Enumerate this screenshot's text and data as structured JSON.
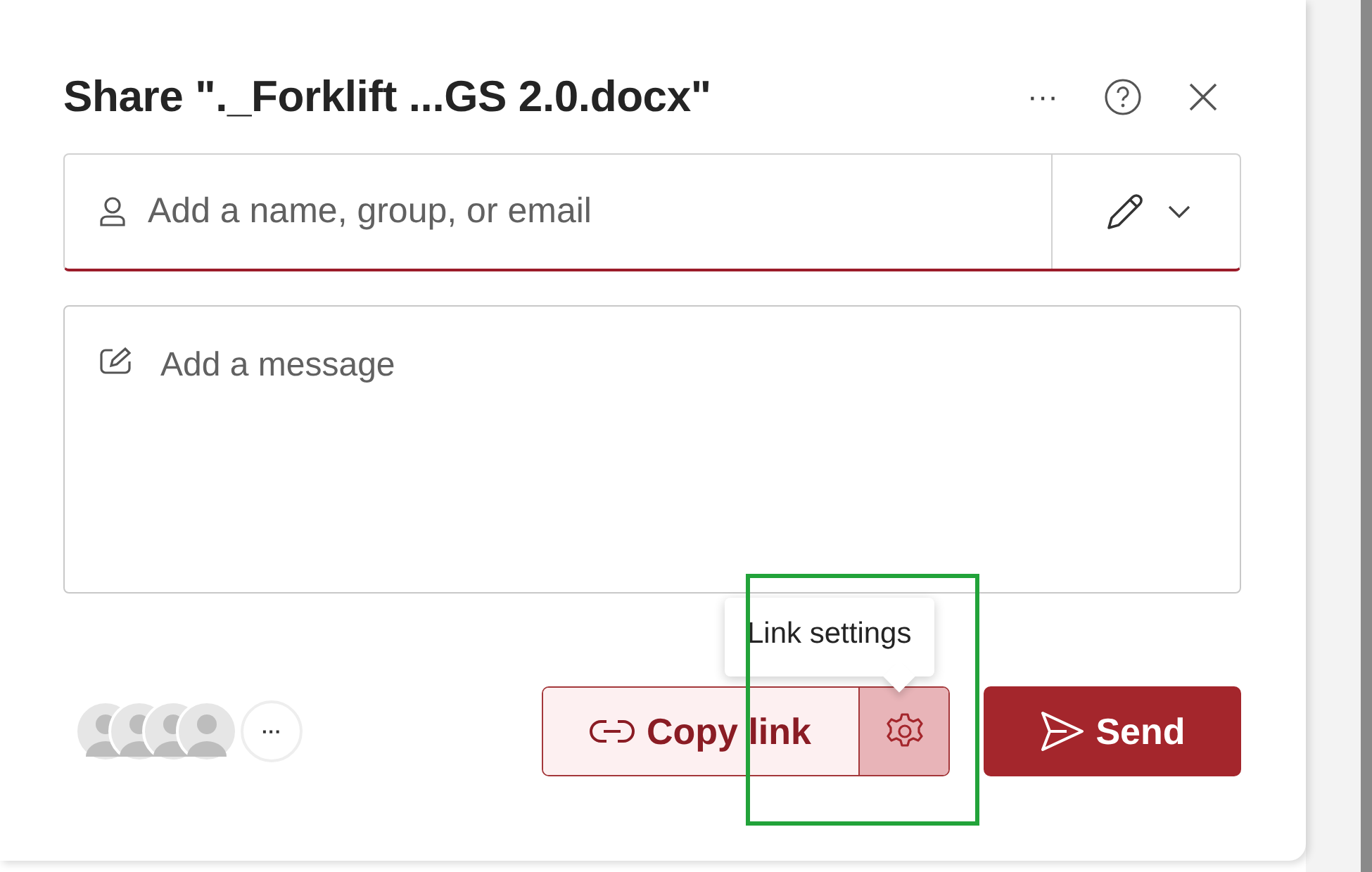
{
  "dialog": {
    "title": "Share \"._Forklift ...GS 2.0.docx\"",
    "header_buttons": [
      {
        "kind": "more",
        "label": "···"
      },
      {
        "kind": "help"
      },
      {
        "kind": "close"
      }
    ]
  },
  "recipients": {
    "placeholder": "Add a name, group, or email",
    "focused": true
  },
  "message": {
    "placeholder": "Add a message"
  },
  "avatars": {
    "people": [
      {
        "kind": "person"
      },
      {
        "kind": "person"
      },
      {
        "kind": "person"
      },
      {
        "kind": "person"
      }
    ],
    "more_label": "···"
  },
  "copy_link": {
    "label": "Copy link"
  },
  "link_settings": {
    "tooltip": "Link settings",
    "hovered": true
  },
  "send": {
    "label": "Send"
  },
  "annotation": {
    "kind": "rectangle",
    "color": "#22a33a"
  }
}
